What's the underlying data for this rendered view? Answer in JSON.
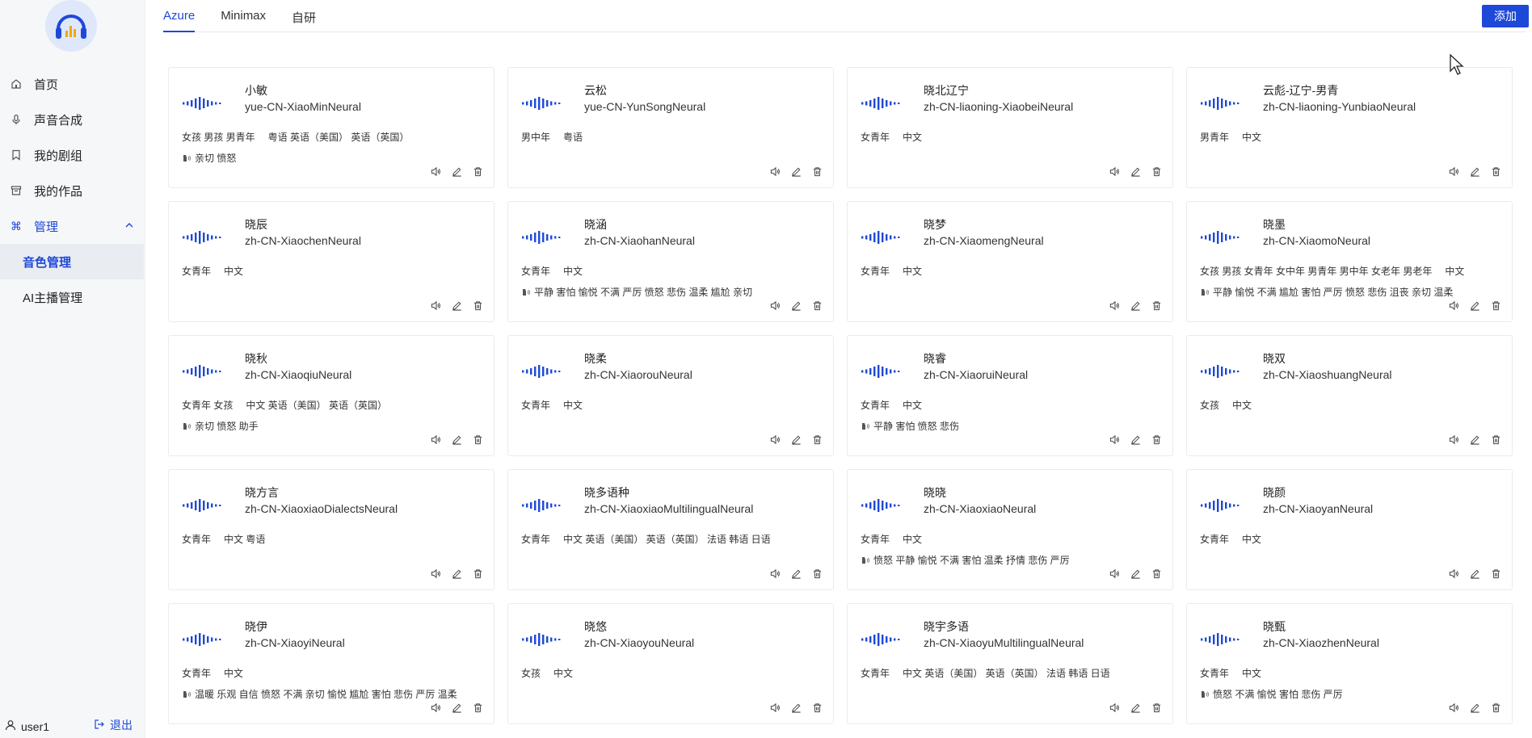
{
  "sidebar": {
    "nav": [
      {
        "label": "首页",
        "icon": "home-icon"
      },
      {
        "label": "声音合成",
        "icon": "microphone-icon"
      },
      {
        "label": "我的剧组",
        "icon": "bookmark-icon"
      },
      {
        "label": "我的作品",
        "icon": "archive-icon"
      }
    ],
    "group": {
      "label": "管理",
      "icon": "command-icon"
    },
    "sub": [
      {
        "label": "音色管理",
        "active": true
      },
      {
        "label": "AI主播管理",
        "active": false
      }
    ],
    "user": "user1",
    "logout": "退出"
  },
  "tabs": [
    "Azure",
    "Minimax",
    "自研"
  ],
  "active_tab": "Azure",
  "add_label": "添加",
  "accent": "#1e48d8",
  "cards": [
    {
      "name": "小敏",
      "id": "yue-CN-XiaoMinNeural",
      "roles": "女孩 男孩 男青年",
      "langs": "粤语 英语（美国） 英语（英国）",
      "emotions": "亲切 愤怒"
    },
    {
      "name": "云松",
      "id": "yue-CN-YunSongNeural",
      "roles": "男中年",
      "langs": "粤语",
      "emotions": ""
    },
    {
      "name": "晓北辽宁",
      "id": "zh-CN-liaoning-XiaobeiNeural",
      "roles": "女青年",
      "langs": "中文",
      "emotions": ""
    },
    {
      "name": "云彪-辽宁-男青",
      "id": "zh-CN-liaoning-YunbiaoNeural",
      "roles": "男青年",
      "langs": "中文",
      "emotions": ""
    },
    {
      "name": "晓辰",
      "id": "zh-CN-XiaochenNeural",
      "roles": "女青年",
      "langs": "中文",
      "emotions": ""
    },
    {
      "name": "晓涵",
      "id": "zh-CN-XiaohanNeural",
      "roles": "女青年",
      "langs": "中文",
      "emotions": "平静 害怕 愉悦 不满 严厉 愤怒 悲伤 温柔 尴尬 亲切"
    },
    {
      "name": "晓梦",
      "id": "zh-CN-XiaomengNeural",
      "roles": "女青年",
      "langs": "中文",
      "emotions": ""
    },
    {
      "name": "晓墨",
      "id": "zh-CN-XiaomoNeural",
      "roles": "女孩 男孩 女青年 女中年 男青年 男中年 女老年 男老年",
      "langs": "中文",
      "emotions": "平静 愉悦 不满 尴尬 害怕 严厉 愤怒 悲伤 沮丧 亲切 温柔"
    },
    {
      "name": "晓秋",
      "id": "zh-CN-XiaoqiuNeural",
      "roles": "女青年 女孩",
      "langs": "中文 英语（美国） 英语（英国）",
      "emotions": "亲切 愤怒 助手"
    },
    {
      "name": "晓柔",
      "id": "zh-CN-XiaorouNeural",
      "roles": "女青年",
      "langs": "中文",
      "emotions": ""
    },
    {
      "name": "晓睿",
      "id": "zh-CN-XiaoruiNeural",
      "roles": "女青年",
      "langs": "中文",
      "emotions": "平静 害怕 愤怒 悲伤"
    },
    {
      "name": "晓双",
      "id": "zh-CN-XiaoshuangNeural",
      "roles": "女孩",
      "langs": "中文",
      "emotions": ""
    },
    {
      "name": "晓方言",
      "id": "zh-CN-XiaoxiaoDialectsNeural",
      "roles": "女青年",
      "langs": "中文 粤语",
      "emotions": ""
    },
    {
      "name": "晓多语种",
      "id": "zh-CN-XiaoxiaoMultilingualNeural",
      "roles": "女青年",
      "langs": "中文 英语（美国） 英语（英国） 法语 韩语 日语",
      "emotions": ""
    },
    {
      "name": "晓晓",
      "id": "zh-CN-XiaoxiaoNeural",
      "roles": "女青年",
      "langs": "中文",
      "emotions": "愤怒 平静 愉悦 不满 害怕 温柔 抒情 悲伤 严厉"
    },
    {
      "name": "晓颜",
      "id": "zh-CN-XiaoyanNeural",
      "roles": "女青年",
      "langs": "中文",
      "emotions": ""
    },
    {
      "name": "晓伊",
      "id": "zh-CN-XiaoyiNeural",
      "roles": "女青年",
      "langs": "中文",
      "emotions": "温暖 乐观 自信 愤怒 不满 亲切 愉悦 尴尬 害怕 悲伤 严厉 温柔"
    },
    {
      "name": "晓悠",
      "id": "zh-CN-XiaoyouNeural",
      "roles": "女孩",
      "langs": "中文",
      "emotions": ""
    },
    {
      "name": "晓宇多语",
      "id": "zh-CN-XiaoyuMultilingualNeural",
      "roles": "女青年",
      "langs": "中文 英语（美国） 英语（英国） 法语 韩语 日语",
      "emotions": ""
    },
    {
      "name": "晓甄",
      "id": "zh-CN-XiaozhenNeural",
      "roles": "女青年",
      "langs": "中文",
      "emotions": "愤怒 不满 愉悦 害怕 悲伤 严厉"
    }
  ]
}
